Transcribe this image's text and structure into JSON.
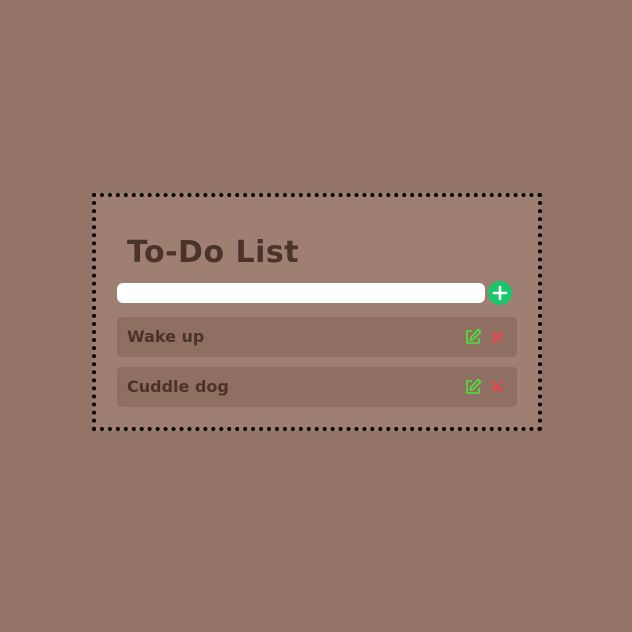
{
  "app": {
    "title": "To-Do List"
  },
  "input": {
    "value": "",
    "placeholder": ""
  },
  "add_button": {
    "icon": "plus-icon"
  },
  "todos": [
    {
      "text": "Wake up",
      "edit_icon": "edit-icon",
      "delete_icon": "close-icon"
    },
    {
      "text": "Cuddle dog",
      "edit_icon": "edit-icon",
      "delete_icon": "close-icon"
    }
  ],
  "colors": {
    "background": "#927365",
    "card": "#9f7f71",
    "item": "#8e6f62",
    "text": "#4a3329",
    "add_button": "#16c76b",
    "edit_icon": "#4be43a",
    "delete_icon": "#e5474c"
  }
}
